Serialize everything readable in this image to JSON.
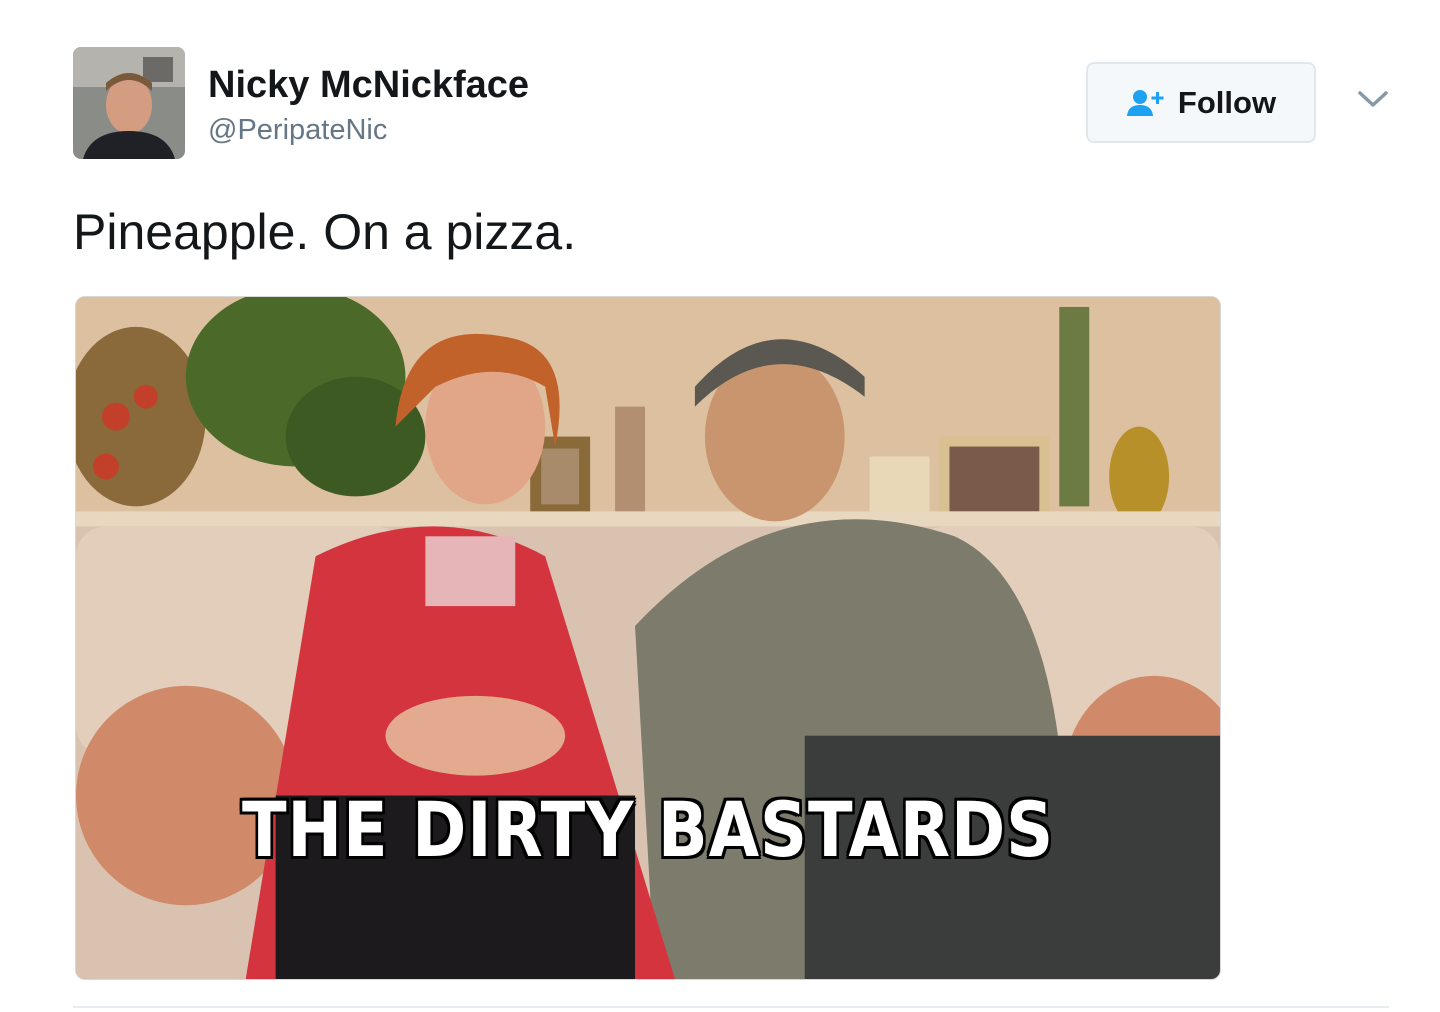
{
  "author": {
    "display_name": "Nicky McNickface",
    "handle": "@PeripateNic"
  },
  "follow_button": {
    "label": "Follow",
    "icon": "add-user-icon"
  },
  "menu": {
    "icon": "chevron-down-icon"
  },
  "tweet": {
    "text": "Pineapple. On a pizza."
  },
  "media": {
    "caption": "THE DIRTY BASTARDS"
  },
  "colors": {
    "follow_icon": "#1da1f2",
    "handle": "#657786",
    "text": "#14171a"
  }
}
